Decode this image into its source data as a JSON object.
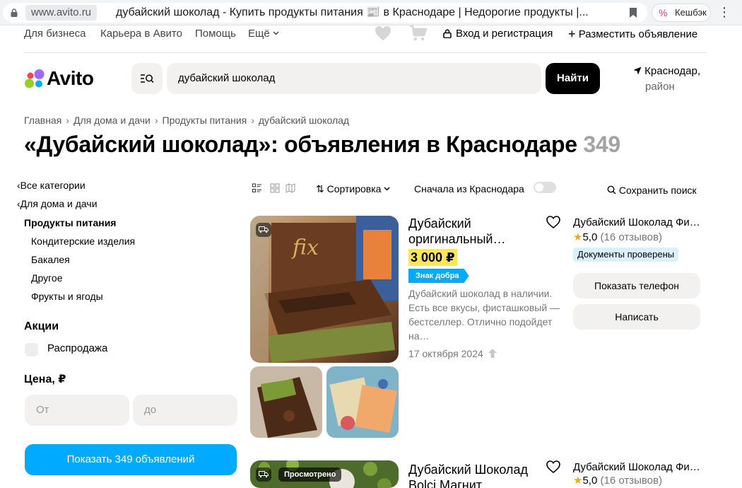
{
  "browser": {
    "domain": "www.avito.ru",
    "title": "дубайский шоколад - Купить продукты питания 📰 в Краснодаре | Недорогие продукты |...",
    "cashback": "Кешбэк"
  },
  "topnav": {
    "links": [
      "Для бизнеса",
      "Карьера в Авито",
      "Помощь",
      "Ещё"
    ],
    "login": "Вход и регистрация",
    "post_ad": "Разместить объявление"
  },
  "header": {
    "logo": "Avito",
    "search_value": "дубайский шоколад",
    "find": "Найти",
    "location_line1": "Краснодар,",
    "location_line2": "район"
  },
  "breadcrumb": [
    "Главная",
    "Для дома и дачи",
    "Продукты питания",
    "дубайский шоколад"
  ],
  "title": {
    "text": "«Дубайский шоколад»: объявления в Краснодаре",
    "count": "349"
  },
  "sidebar": {
    "back_all": "Все категории",
    "back_home": "Для дома и дачи",
    "current": "Продукты питания",
    "subcategories": [
      "Кондитерские изделия",
      "Бакалея",
      "Другое",
      "Фрукты и ягоды"
    ],
    "promo_head": "Акции",
    "sale": "Распродажа",
    "price_head": "Цена, ₽",
    "price_from": "От",
    "price_to": "до",
    "show_btn": "Показать 349 объявлений"
  },
  "toolbar": {
    "sort": "Сортировка",
    "from_city": "Сначала из Краснодара",
    "save_search": "Сохранить поиск"
  },
  "listings": [
    {
      "title": "Дубайский оригинальный…",
      "price": "3 000 ₽",
      "badge": "Знак добра",
      "description": "Дубайский шоколад в наличии. Есть все вкусы, фисташковый — бестселлер. Отлично подойдет на…",
      "date": "17 октября 2024",
      "seller": "Дубайский Шоколад Фи…",
      "rating": "5,0",
      "reviews": "(16 отзывов)",
      "docs": "Документы проверены",
      "show_phone": "Показать телефон",
      "write": "Написать"
    },
    {
      "title": "Дубайский Шоколад Bolci Магнит",
      "seen": "Просмотрено",
      "seller": "Дубайский Шоколад Фи…",
      "rating": "5,0",
      "reviews": "(16 отзывов)"
    }
  ],
  "colors": {
    "accent_blue": "#00aaff",
    "price_highlight": "#ffe55c",
    "logo_green": "#97cf26",
    "logo_blue": "#00aaff",
    "logo_red": "#ff4053",
    "logo_purple": "#a169f7"
  }
}
